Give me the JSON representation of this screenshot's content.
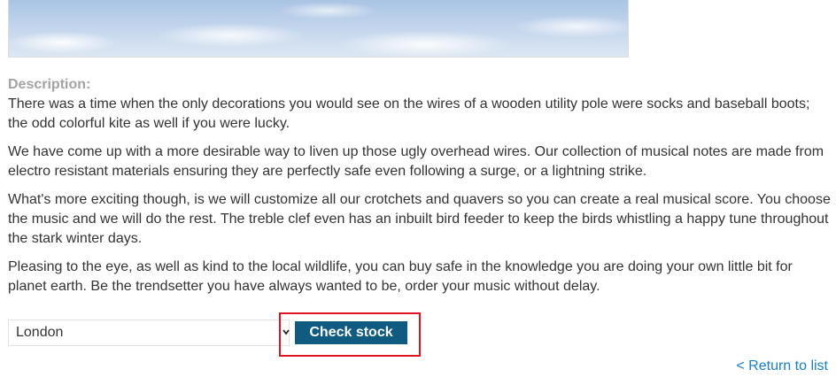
{
  "description": {
    "label": "Description:",
    "paragraphs": [
      "There was a time when the only decorations you would see on the wires of a wooden utility pole were socks and baseball boots; the odd colorful kite as well if you were lucky.",
      "We have come up with a more desirable way to liven up those ugly overhead wires. Our collection of musical notes are made from electro resistant materials ensuring they are perfectly safe even following a surge, or a lightning strike.",
      "What's more exciting though, is we will customize all our crotchets and quavers so you can create a real musical score. You choose the music and we will do the rest. The treble clef even has an inbuilt bird feeder to keep the birds whistling a happy tune throughout the stark winter days.",
      "Pleasing to the eye, as well as kind to the local wildlife, you can buy safe in the knowledge you are doing your own little bit for planet earth. Be the trendsetter you have always wanted to be, order your music without delay."
    ]
  },
  "stock_form": {
    "selected_store": "London",
    "check_button_label": "Check stock"
  },
  "return_link": "< Return to list",
  "colors": {
    "button_bg": "#105c80",
    "highlight_border": "#e0141e",
    "link": "#1a7fc1",
    "label": "#a3a3a3"
  }
}
